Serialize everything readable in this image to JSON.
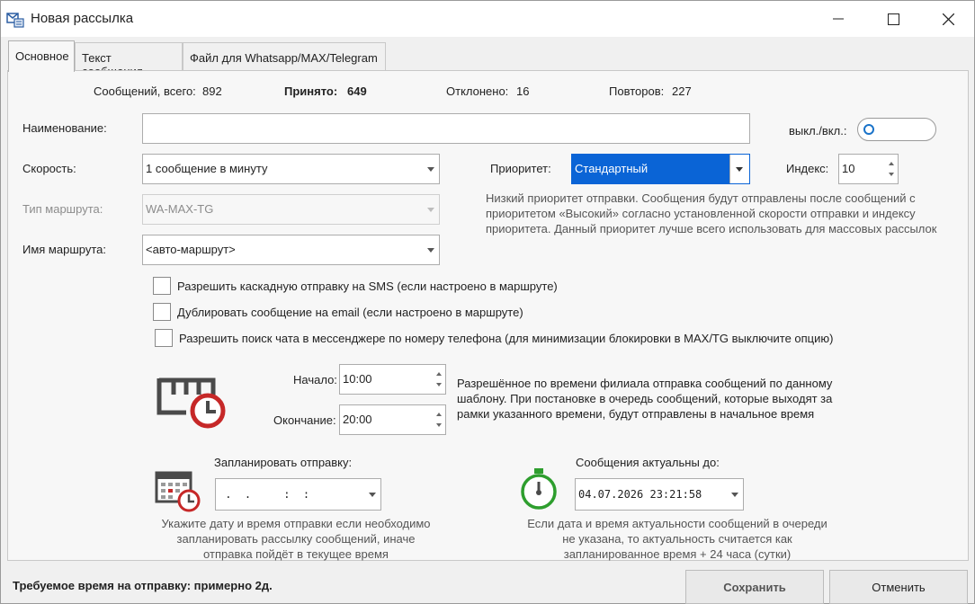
{
  "window": {
    "title": "Новая рассылка",
    "minimize_glyph": "—",
    "maximize_glyph": "☐",
    "close_glyph": "✕"
  },
  "tabs": [
    {
      "label": "Основное",
      "active": true
    },
    {
      "label": "Текст сообщения",
      "active": false
    },
    {
      "label": "Файл для Whatsapp/MAX/Telegram",
      "active": false
    }
  ],
  "stats": {
    "total_label": "Сообщений, всего:",
    "total_value": "892",
    "accepted_label": "Принято:",
    "accepted_value": "649",
    "rejected_label": "Отклонено:",
    "rejected_value": "16",
    "repeats_label": "Повторов:",
    "repeats_value": "227"
  },
  "form": {
    "name_label": "Наименование:",
    "name_value": "",
    "toggle_label": "выкл./вкл.:",
    "toggle_on": false,
    "speed_label": "Скорость:",
    "speed_value": "1 сообщение в минуту",
    "priority_label": "Приоритет:",
    "priority_value": "Стандартный",
    "index_label": "Индекс:",
    "index_value": "10",
    "priority_note": "Низкий приоритет отправки. Сообщения будут отправлены после сообщений с приоритетом «Высокий» согласно установленной скорости отправки и индексу приоритета. Данный приоритет лучше всего использовать для массовых рассылок",
    "route_type_label": "Тип маршрута:",
    "route_type_value": "WA-MAX-TG",
    "route_name_label": "Имя маршрута:",
    "route_name_value": "<авто-маршрут>"
  },
  "checkboxes": [
    {
      "label": "Разрешить каскадную отправку на SMS (если настроено в маршруте)",
      "checked": false
    },
    {
      "label": "Дублировать сообщение на email (если настроено в маршруте)",
      "checked": false
    },
    {
      "label": "Разрешить поиск чата в мессенджере по номеру телефона (для минимизации блокировки в MAX/TG выключите опцию)",
      "checked": false
    }
  ],
  "schedule_window": {
    "icon": "calendar-clock-icon",
    "start_label": "Начало:",
    "start_value": "10:00",
    "end_label": "Окончание:",
    "end_value": "20:00",
    "note": "Разрешённое по времени филиала отправка сообщений по данному шаблону. При постановке в очередь сообщений, которые выходят за рамки указанного времени, будут отправлены в начальное время"
  },
  "planned": {
    "icon": "calendar-schedule-icon",
    "label": "Запланировать отправку:",
    "value": " .  .     :  :",
    "note": "Укажите дату и время отправки если необходимо запланировать рассылку сообщений, иначе отправка пойдёт в текущее время"
  },
  "valid_until": {
    "icon": "stopwatch-icon",
    "label": "Сообщения актуальны до:",
    "value": "04.07.2026 23:21:58",
    "note": "Если дата и время актуальности сообщений в очереди не указана, то актуальность считается как запланированное время + 24 часа (сутки)"
  },
  "footer": {
    "estimate": "Требуемое время на отправку: примерно 2д.",
    "save_label": "Сохранить",
    "cancel_label": "Отменить"
  },
  "colors": {
    "accent": "#0a64d6",
    "clock_red": "#c62828",
    "stopwatch_green": "#2e9e2e"
  }
}
